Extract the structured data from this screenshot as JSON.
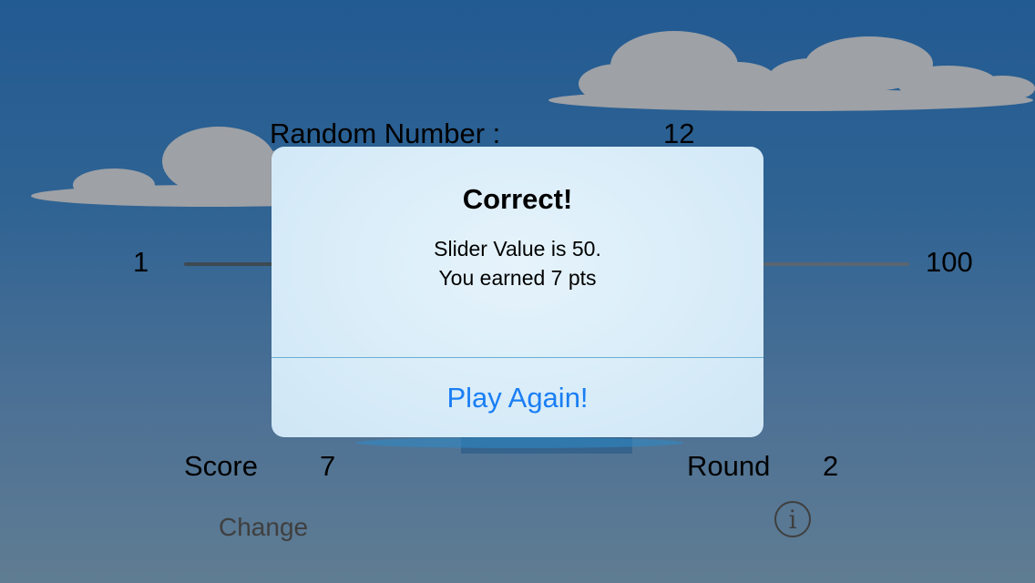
{
  "header": {
    "random_label": "Random Number :",
    "random_value": "12"
  },
  "slider": {
    "min_label": "1",
    "max_label": "100",
    "value": 50
  },
  "stats": {
    "score_label": "Score",
    "score_value": "7",
    "round_label": "Round",
    "round_value": "2"
  },
  "buttons": {
    "change_label": "Change",
    "info_icon": "info-icon"
  },
  "alert": {
    "title": "Correct!",
    "message_line1": "Slider Value is 50.",
    "message_line2": "You earned 7 pts",
    "button_label": "Play Again!"
  },
  "colors": {
    "alert_button": "#1a7ef4",
    "cloud": "#9ea1a6"
  }
}
